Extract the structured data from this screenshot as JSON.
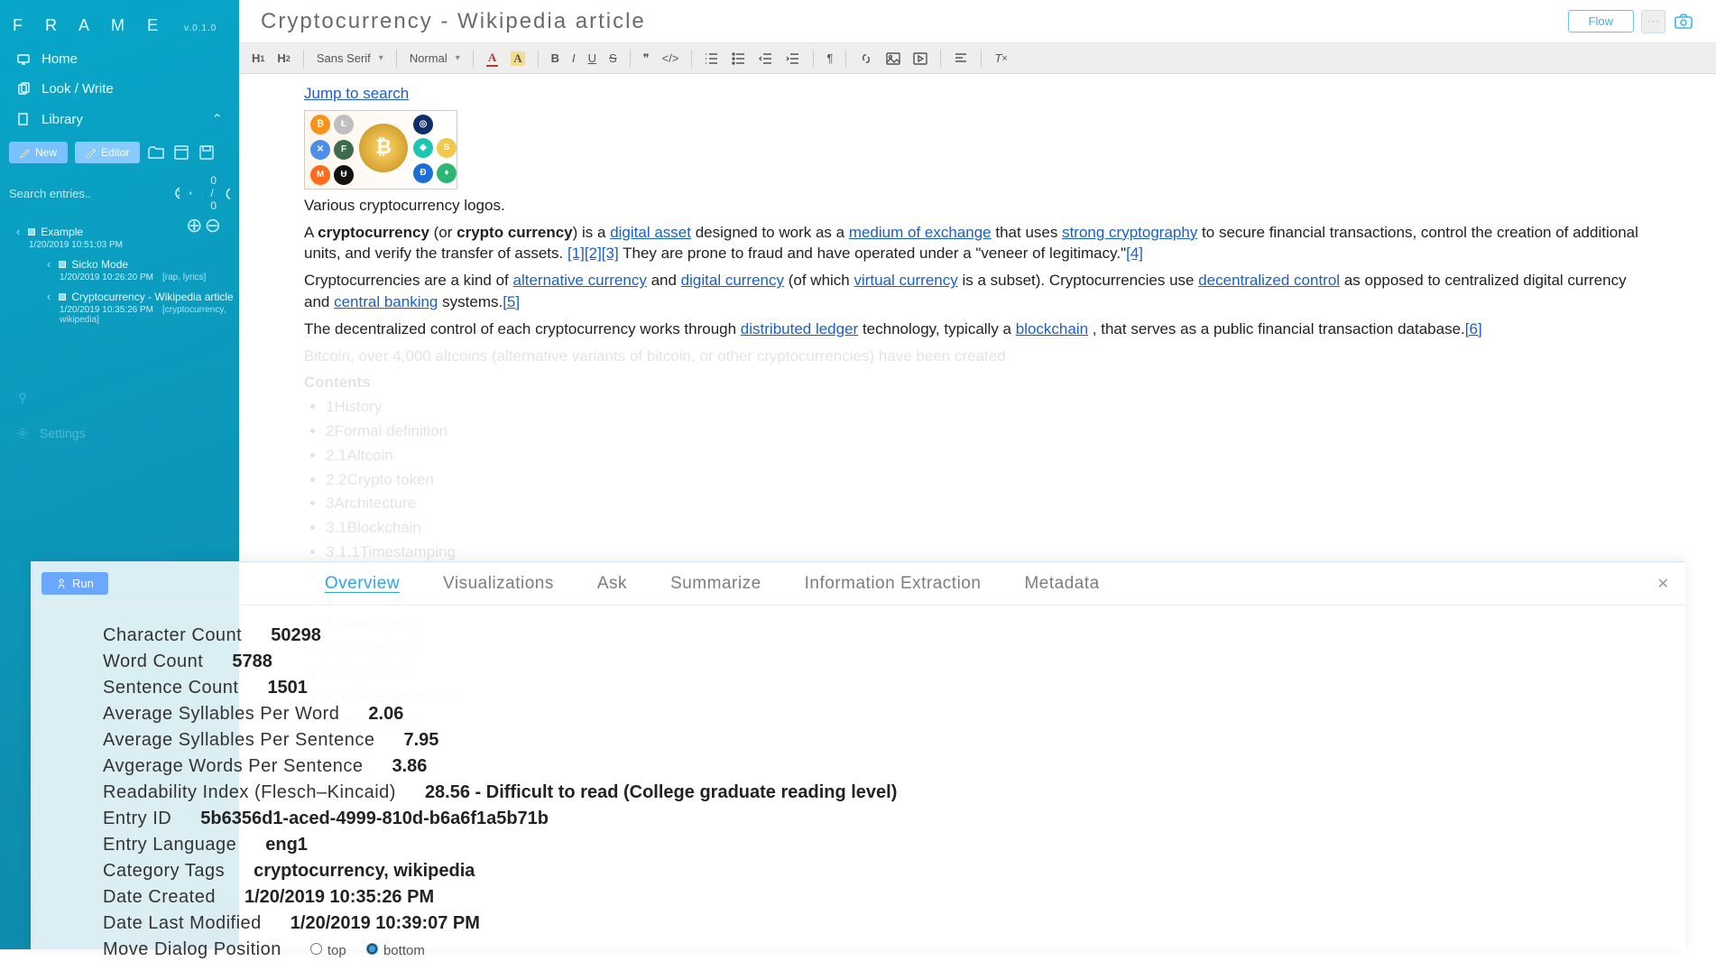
{
  "app": {
    "name": "F R A M E",
    "version": "v.0.1.0"
  },
  "nav": {
    "home": "Home",
    "look_write": "Look / Write",
    "library": "Library"
  },
  "sidebar_actions": {
    "new": "New",
    "editor": "Editor"
  },
  "sidebar_search": {
    "placeholder": "Search entries..",
    "pager": "0 / 0"
  },
  "tree": {
    "root": {
      "label": "Example",
      "ts": "1/20/2019 10:51:03 PM"
    },
    "children": [
      {
        "label": "Sicko Mode",
        "ts": "1/20/2019 10:26:20 PM",
        "tags": "[rap, lyrics]"
      },
      {
        "label": "Cryptocurrency - Wikipedia article",
        "ts": "1/20/2019 10:35:26 PM",
        "tags": "[cryptocurrency, wikipedia]"
      }
    ]
  },
  "sidebar_lower": {
    "settings": "Settings",
    "pinned": ""
  },
  "header": {
    "title": "Cryptocurrency - Wikipedia article",
    "flow": "Flow"
  },
  "toolbar": {
    "h1": "H",
    "h2": "H",
    "font": "Sans Serif",
    "size": "Normal"
  },
  "editor": {
    "jump": "Jump to search",
    "caption": "Various cryptocurrency logos.",
    "p1a": "A ",
    "p1bold1": "cryptocurrency",
    "p1b": " (or ",
    "p1bold2": "crypto currency",
    "p1c": ") is a ",
    "link_digital_asset": "digital asset",
    "p1d": " designed to work as a ",
    "link_medium": "medium of exchange",
    "p1e": " that uses ",
    "link_strong": "strong cryptography",
    "p1f": " to secure financial transactions, control the creation of additional units, and verify the transfer of assets.",
    "ref1": "[1]",
    "ref2": "[2]",
    "ref3": "[3]",
    "p1g": " They are prone to fraud and have operated under a \"veneer of legitimacy.\"",
    "ref4": "[4]",
    "p2a": "Cryptocurrencies are a kind of ",
    "link_alt": "alternative currency",
    "p2b": " and ",
    "link_digc": "digital currency",
    "p2c": " (of which ",
    "link_virtc": "virtual currency",
    "p2d": " is a subset). Cryptocurrencies use ",
    "link_decen": "decentralized control",
    "p2e": " as opposed to centralized digital currency and ",
    "link_cbank": "central banking",
    "p2f": " systems.",
    "ref5": "[5]",
    "p3a": "The decentralized control of each cryptocurrency works through ",
    "link_distl": "distributed ledger",
    "p3b": " technology, typically a ",
    "link_blockc": "blockchain",
    "p3c": ", that serves as a public financial transaction database.",
    "ref6": "[6]",
    "ghost_line": "Bitcoin, over 4,000 altcoins (alternative variants of bitcoin, or other cryptocurrencies) have been created",
    "contents_title": "Contents",
    "contents": [
      "1History",
      "2Formal definition",
      "2.1Altcoin",
      "2.2Crypto token",
      "3Architecture",
      "3.1Blockchain",
      "3.1.1Timestamping",
      "3.2Mining",
      "3.3Wallets",
      "3.4Anonymity",
      "3.5Fungibility",
      "4Economics",
      "4.1Transaction fees",
      "4.2Exchanges"
    ]
  },
  "dialog": {
    "run": "Run",
    "tabs": [
      "Overview",
      "Visualizations",
      "Ask",
      "Summarize",
      "Information Extraction",
      "Metadata"
    ],
    "active_tab": 0,
    "rows": [
      {
        "label": "Character Count",
        "value": "50298"
      },
      {
        "label": "Word Count",
        "value": "5788"
      },
      {
        "label": "Sentence Count",
        "value": "1501"
      },
      {
        "label": "Average Syllables Per Word",
        "value": "2.06"
      },
      {
        "label": "Average Syllables Per Sentence",
        "value": "7.95"
      },
      {
        "label": "Avgerage Words Per Sentence",
        "value": "3.86"
      },
      {
        "label": "Readability Index (Flesch–Kincaid)",
        "value": "28.56 - Difficult to read (College graduate reading level)"
      },
      {
        "label": "Entry ID",
        "value": "5b6356d1-aced-4999-810d-b6a6f1a5b71b"
      },
      {
        "label": "Entry Language",
        "value": "eng1"
      },
      {
        "label": "Category Tags",
        "value": "cryptocurrency, wikipedia"
      },
      {
        "label": "Date Created",
        "value": "1/20/2019 10:35:26 PM"
      },
      {
        "label": "Date Last Modified",
        "value": "1/20/2019 10:39:07 PM"
      }
    ],
    "move_label": "Move Dialog Position",
    "radio_top": "top",
    "radio_bottom": "bottom"
  }
}
